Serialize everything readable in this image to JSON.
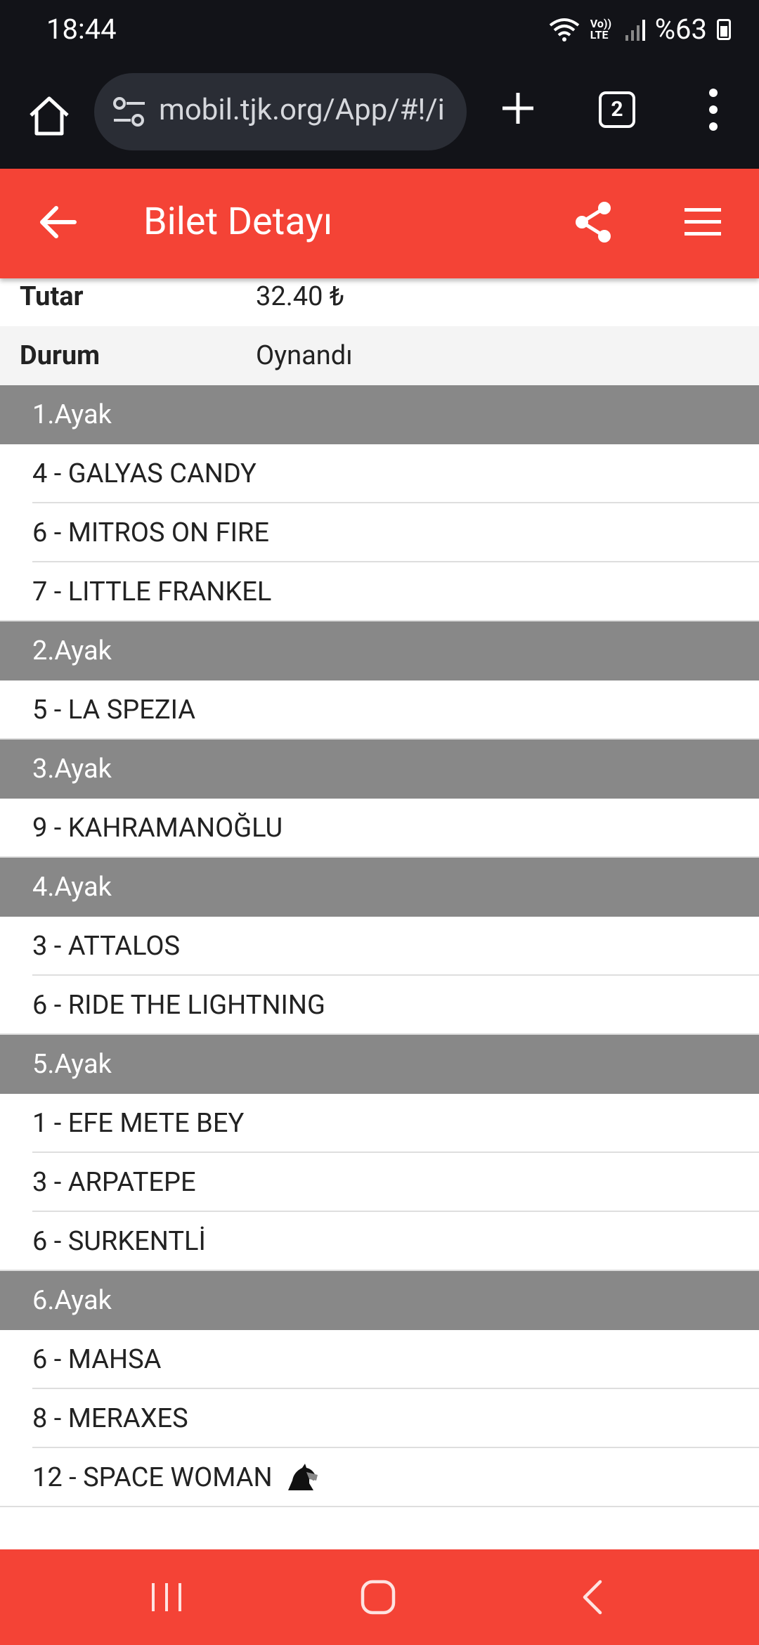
{
  "status_bar": {
    "time": "18:44",
    "network": "Vo)) LTE",
    "battery": "%63"
  },
  "browser": {
    "url": "mobil.tjk.org/App/#!/i",
    "tab_count": "2"
  },
  "header": {
    "title": "Bilet Detayı"
  },
  "info": [
    {
      "label": "Tutar",
      "value": "32.40 ₺"
    },
    {
      "label": "Durum",
      "value": "Oynandı"
    }
  ],
  "legs": [
    {
      "title": "1.Ayak",
      "horses": [
        "4 - GALYAS CANDY",
        "6 - MITROS ON FIRE",
        "7 - LITTLE FRANKEL"
      ]
    },
    {
      "title": "2.Ayak",
      "horses": [
        "5 - LA SPEZIA"
      ]
    },
    {
      "title": "3.Ayak",
      "horses": [
        "9 - KAHRAMANOĞLU"
      ]
    },
    {
      "title": "4.Ayak",
      "horses": [
        "3 - ATTALOS",
        "6 - RIDE THE LIGHTNING"
      ]
    },
    {
      "title": "5.Ayak",
      "horses": [
        "1 - EFE METE BEY",
        "3 - ARPATEPE",
        "6 - SURKENTLİ"
      ]
    },
    {
      "title": "6.Ayak",
      "horses": [
        "6 - MAHSA",
        "8 - MERAXES",
        "12 - SPACE WOMAN"
      ]
    }
  ],
  "icons": {
    "winner_marker": "horse-knight-icon"
  },
  "colors": {
    "header": "#f44336",
    "leg_header": "#888888",
    "browser_bar": "#121318"
  }
}
